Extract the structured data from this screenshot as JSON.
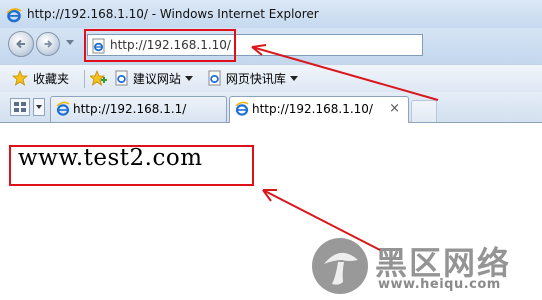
{
  "window": {
    "title": "http://192.168.1.10/ - Windows Internet Explorer"
  },
  "address_bar": {
    "url": "http://192.168.1.10/"
  },
  "favorites_bar": {
    "favorites_label": "收藏夹",
    "items": [
      {
        "label": "建议网站"
      },
      {
        "label": "网页快讯库"
      }
    ]
  },
  "tabs": [
    {
      "label": "http://192.168.1.1/",
      "active": false
    },
    {
      "label": "http://192.168.1.10/",
      "active": true,
      "close": "×"
    }
  ],
  "page": {
    "text": "www.test2.com"
  },
  "annotations": {
    "highlight_color": "#e0101a",
    "arrow_color": "#d9171c"
  },
  "watermark": {
    "brand": "黑区网络",
    "url": "www.heiqu.com"
  }
}
